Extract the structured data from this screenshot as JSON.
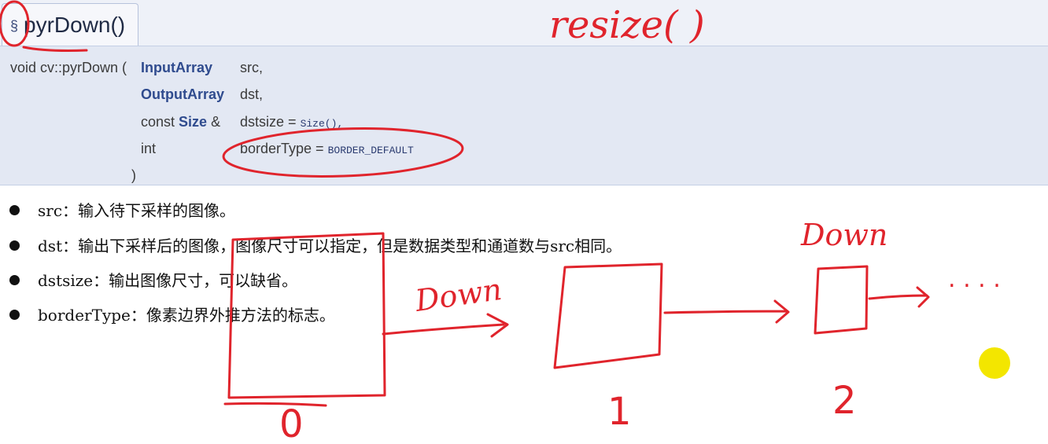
{
  "header": {
    "section_symbol": "§",
    "title": "pyrDown()"
  },
  "prototype": {
    "prefix": "void cv::pyrDown (",
    "params": [
      {
        "type_pre": "",
        "type": "InputArray",
        "type_post": "",
        "name": "src,",
        "default_op": "",
        "default_val": ""
      },
      {
        "type_pre": "",
        "type": "OutputArray",
        "type_post": "",
        "name": "dst,",
        "default_op": "",
        "default_val": ""
      },
      {
        "type_pre": "const ",
        "type": "Size",
        "type_post": " &",
        "name": "dstsize =",
        "default_op": "",
        "default_val": "Size(),"
      },
      {
        "type_pre": "int",
        "type": "",
        "type_post": "",
        "name": "borderType =",
        "default_op": "",
        "default_val": "BORDER_DEFAULT"
      }
    ],
    "close": ")"
  },
  "bullets": [
    "src：输入待下采样的图像。",
    "dst：输出下采样后的图像，图像尺寸可以指定，但是数据类型和通道数与src相同。",
    "dstsize：输出图像尺寸，可以缺省。",
    "borderType：像素边界外推方法的标志。"
  ],
  "annotations": {
    "resize_note": "resize(          )",
    "down_label_1": "Down",
    "down_label_2": "Down",
    "level_labels": [
      "0",
      "1",
      "2"
    ],
    "ellipsis": ". . . ."
  },
  "colors": {
    "ink": "#e0242c",
    "cursor": "#f3e600",
    "link_type": "#2f4b8e"
  }
}
